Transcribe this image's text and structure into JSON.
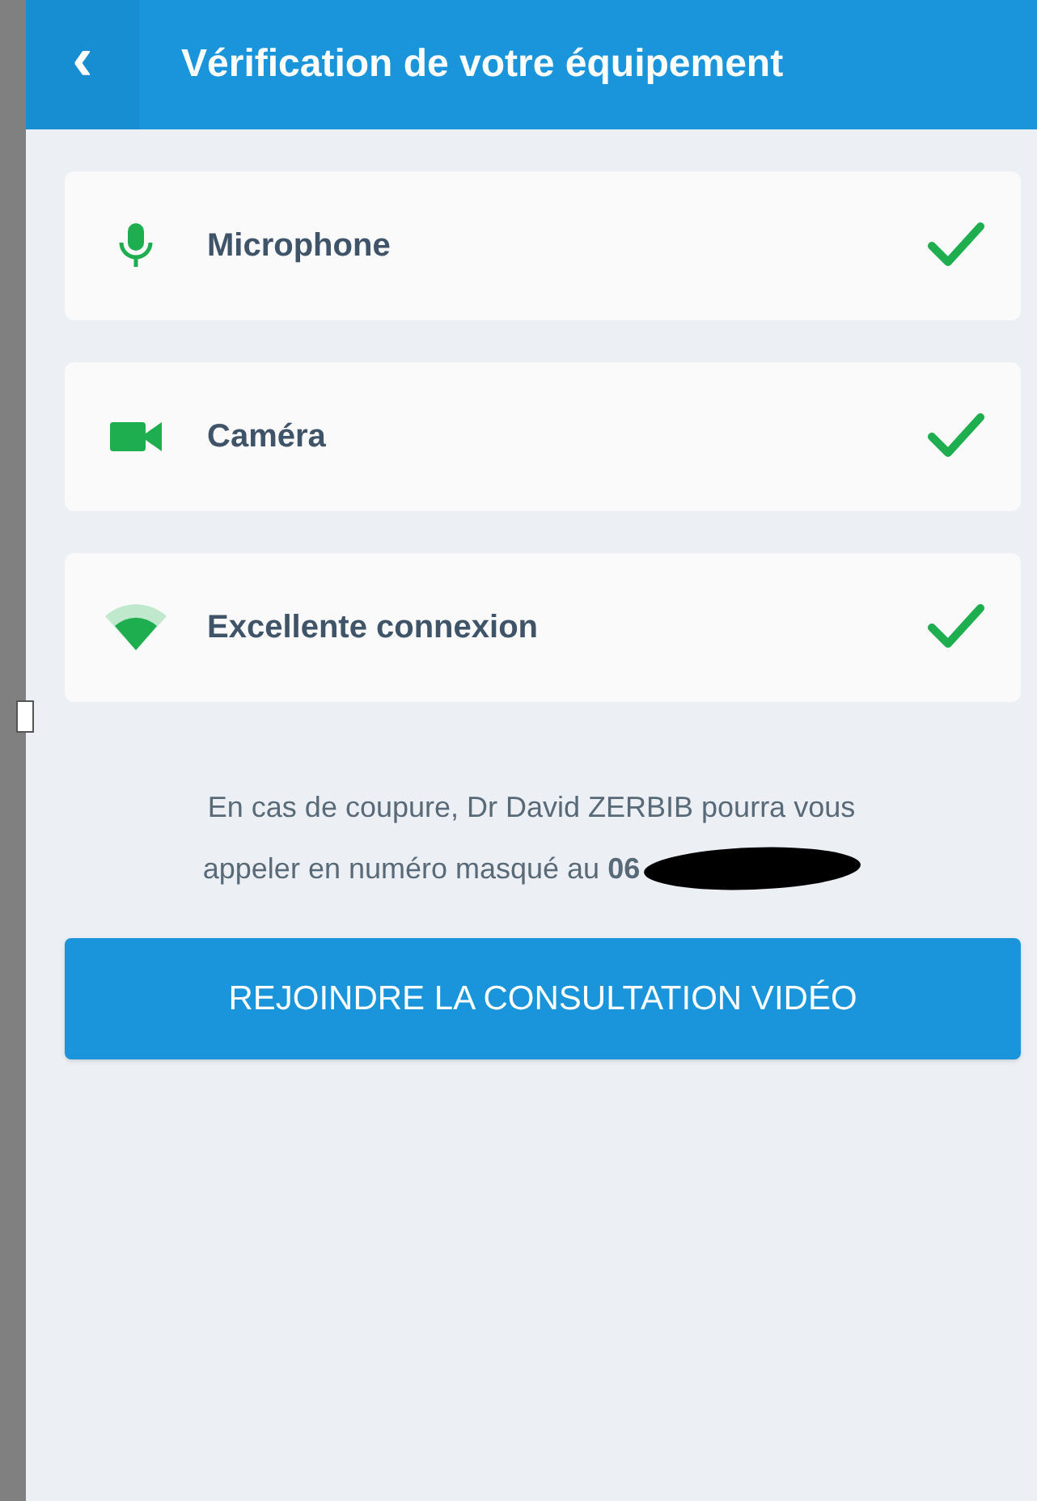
{
  "header": {
    "back": "‹",
    "title": "Vérification de votre équipement"
  },
  "checks": [
    {
      "kind": "microphone",
      "label": "Microphone",
      "checked": true
    },
    {
      "kind": "camera",
      "label": "Caméra",
      "checked": true
    },
    {
      "kind": "wifi",
      "label": "Excellente connexion",
      "checked": true
    }
  ],
  "notice_lines": [
    "En cas de coupure, Dr David ZERBIB pourra vous",
    "appeler en numéro masqué au **06**"
  ],
  "join_button": "REJOINDRE LA CONSULTATION VIDÉO"
}
